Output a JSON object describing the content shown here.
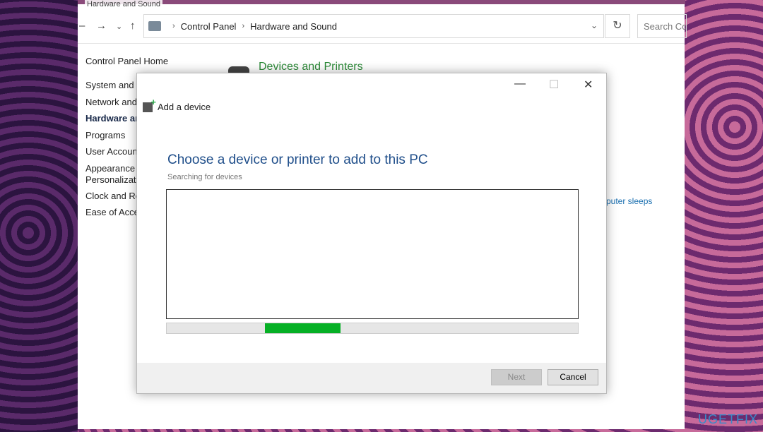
{
  "background_title": "Hardware and Sound",
  "breadcrumb": [
    "Control Panel",
    "Hardware and Sound"
  ],
  "search_placeholder": "Search Co",
  "sidebar": {
    "home": "Control Panel Home",
    "items": [
      "System and S",
      "Network and",
      "Hardware ar",
      "Programs",
      "User Account",
      "Appearance a",
      "Personalizati",
      "Clock and Re",
      "Ease of Acces"
    ]
  },
  "main": {
    "section_title": "Devices and Printers",
    "partial_link": "puter sleeps"
  },
  "dialog": {
    "title": "Add a device",
    "heading": "Choose a device or printer to add to this PC",
    "status": "Searching for devices",
    "next": "Next",
    "cancel": "Cancel",
    "progress_state": "indeterminate",
    "progress_color": "#06b025"
  },
  "watermark": "UGETFIX"
}
